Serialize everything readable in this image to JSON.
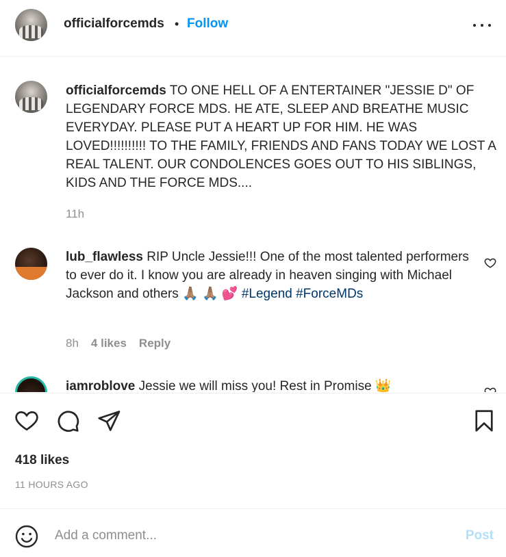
{
  "header": {
    "username": "officialforcemds",
    "separator": "•",
    "follow_label": "Follow",
    "more_icon": "more-horizontal-icon"
  },
  "caption": {
    "username": "officialforcemds",
    "text": " TO ONE HELL OF A ENTERTAINER \"JESSIE D\" OF LEGENDARY FORCE MDS. HE ATE, SLEEP AND BREATHE MUSIC EVERYDAY. PLEASE PUT A HEART UP FOR HIM. HE WAS LOVED!!!!!!!!!! TO THE FAMILY, FRIENDS AND FANS TODAY WE LOST A REAL TALENT. OUR CONDOLENCES GOES OUT TO HIS SIBLINGS, KIDS AND THE FORCE MDS....",
    "time": "11h"
  },
  "comments": [
    {
      "username": "lub_flawless",
      "text": " RIP Uncle Jessie!!! One of the most talented performers to ever do it. I know you are already in heaven singing with Michael Jackson and others 🙏🏽 🙏🏽 💕 ",
      "hashtag1": "#Legend",
      "hashtag2": "#ForceMDs",
      "time": "8h",
      "likes": "4 likes",
      "reply_label": "Reply"
    },
    {
      "username": "iamroblove",
      "text": " Jessie we will miss you! Rest in Promise 👑"
    }
  ],
  "actions": {
    "like_icon": "heart-icon",
    "comment_icon": "comment-icon",
    "share_icon": "share-icon",
    "save_icon": "bookmark-icon",
    "likes_count": "418 likes",
    "timestamp": "11 HOURS AGO"
  },
  "add_comment": {
    "emoji_icon": "emoji-icon",
    "placeholder": "Add a comment...",
    "post_label": "Post"
  },
  "colors": {
    "accent": "#0095f6",
    "post_disabled": "#b2dffc",
    "hashtag": "#00376b",
    "muted": "#8e8e8e"
  }
}
